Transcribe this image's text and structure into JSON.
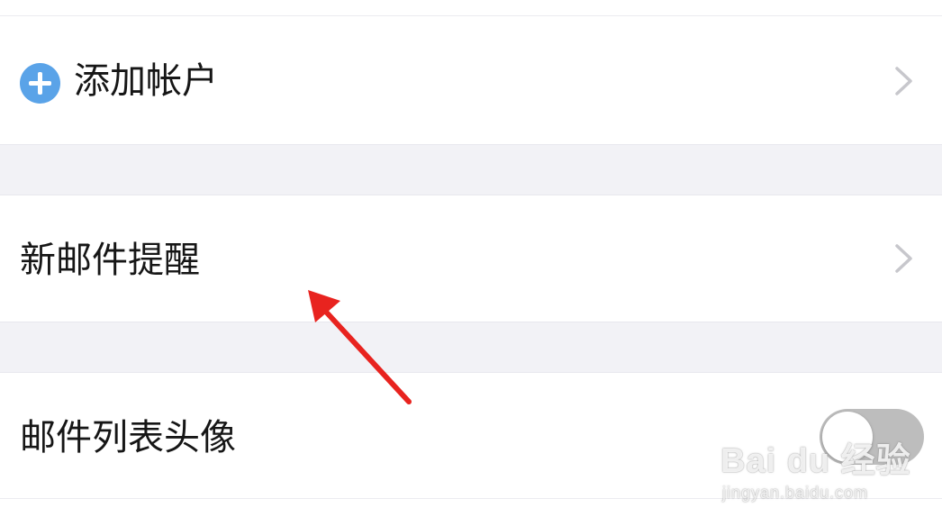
{
  "settings": {
    "add_account": {
      "label": "添加帐户",
      "icon": "plus-circle-icon",
      "icon_color": "#5aa3e8"
    },
    "new_mail_alert": {
      "label": "新邮件提醒",
      "icon": "chevron-right-icon"
    },
    "mail_list_avatar": {
      "label": "邮件列表头像",
      "toggle_on": false
    }
  },
  "annotation": {
    "type": "arrow",
    "color": "#e8231f"
  },
  "watermark": {
    "logo": "Bai du 经验",
    "url": "jingyan.baidu.com"
  },
  "colors": {
    "background": "#ffffff",
    "section_gap": "#f2f2f6",
    "text": "#161616",
    "chevron": "#c7c7cc",
    "toggle_off": "#bdbdbd"
  }
}
